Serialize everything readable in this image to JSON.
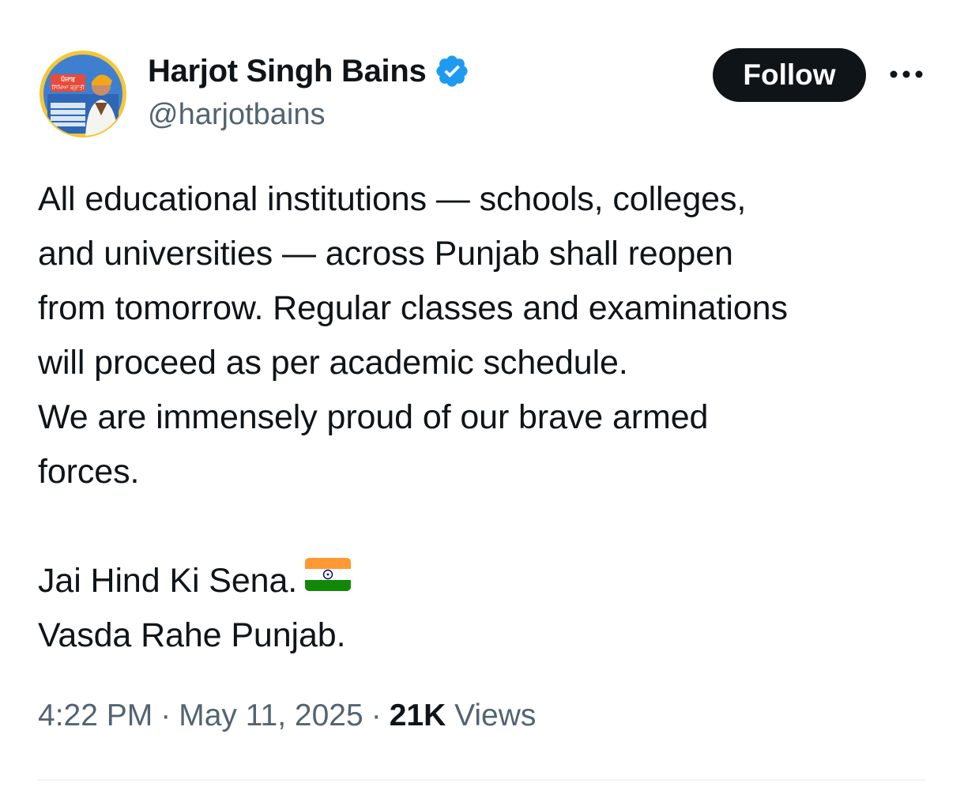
{
  "author": {
    "display_name": "Harjot Singh Bains",
    "handle": "@harjotbains",
    "verified": true,
    "avatar_icon": "profile-avatar",
    "avatar_banner_text": "ਪੰਜਾਬ ਸਿੱਖਿਆ ਕ੍ਰਾਂਤੀ"
  },
  "actions": {
    "follow_label": "Follow",
    "more_icon": "more-horizontal-icon"
  },
  "tweet": {
    "lines": [
      "All educational institutions — schools, colleges,",
      "and universities — across Punjab shall reopen",
      "from tomorrow. Regular classes and examinations",
      "will proceed as per academic schedule.",
      "We are immensely proud of our brave armed",
      "forces."
    ],
    "closing_line_1": "Jai Hind Ki Sena.",
    "closing_line_1_emoji": "india-flag-icon",
    "closing_line_2": "Vasda Rahe Punjab."
  },
  "meta": {
    "time": "4:22 PM",
    "separator": "·",
    "date": "May 11, 2025",
    "views_count": "21K",
    "views_label": "Views"
  },
  "colors": {
    "text_primary": "#0f1419",
    "text_secondary": "#536471",
    "verified_blue": "#1d9bf0",
    "follow_bg": "#0f1419",
    "divider": "#eff3f4"
  }
}
